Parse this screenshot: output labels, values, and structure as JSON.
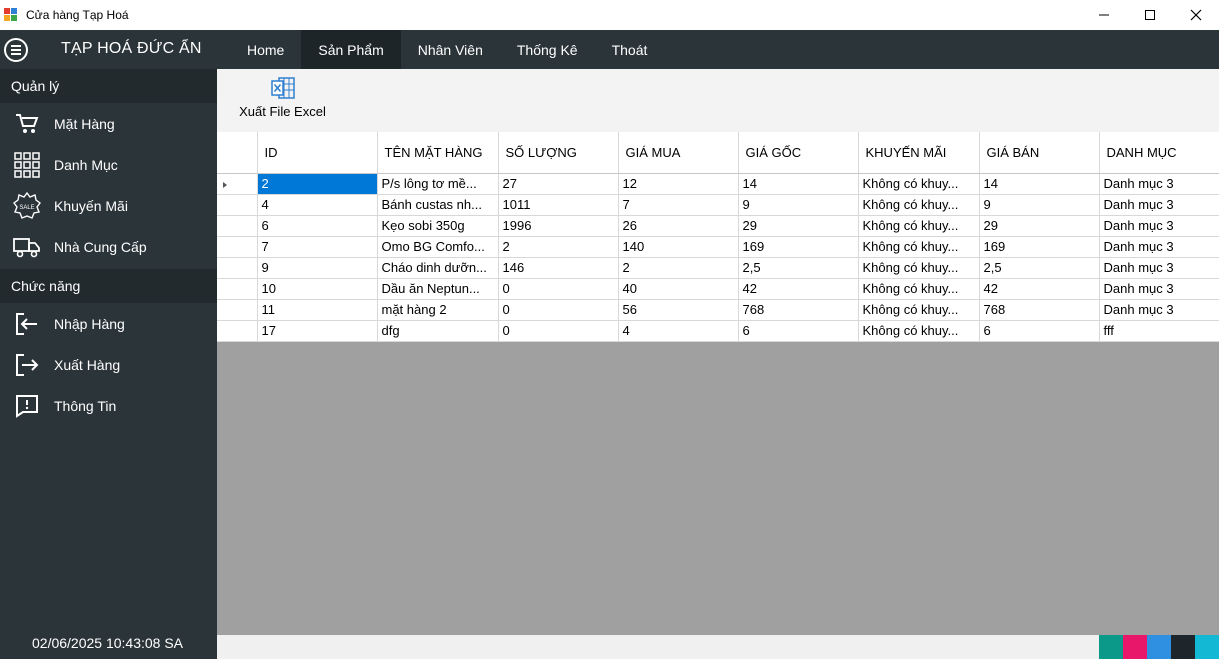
{
  "window": {
    "title": "Cửa hàng Tạp Hoá"
  },
  "header": {
    "brand": "TẠP HOÁ ĐỨC ẨN",
    "nav": [
      {
        "label": "Home",
        "active": false
      },
      {
        "label": "Sản Phẩm",
        "active": true
      },
      {
        "label": "Nhân Viên",
        "active": false
      },
      {
        "label": "Thống Kê",
        "active": false
      },
      {
        "label": "Thoát",
        "active": false
      }
    ]
  },
  "sidebar": {
    "section_manage": "Quản lý",
    "manage_items": [
      {
        "label": "Mặt Hàng",
        "icon": "cart-icon"
      },
      {
        "label": "Danh Mục",
        "icon": "category-grid-icon"
      },
      {
        "label": "Khuyến Mãi",
        "icon": "sale-badge-icon"
      },
      {
        "label": "Nhà Cung Cấp",
        "icon": "truck-icon"
      }
    ],
    "section_functions": "Chức năng",
    "function_items": [
      {
        "label": "Nhập Hàng",
        "icon": "import-icon"
      },
      {
        "label": "Xuất Hàng",
        "icon": "export-icon"
      },
      {
        "label": "Thông Tin",
        "icon": "info-icon"
      }
    ],
    "datetime": "02/06/2025 10:43:08 SA"
  },
  "toolbar": {
    "export_label": "Xuất File Excel"
  },
  "table": {
    "columns": [
      "ID",
      "TÊN MẶT HÀNG",
      "SỐ LƯỢNG",
      "GIÁ MUA",
      "GIÁ GỐC",
      "KHUYẾN MÃI",
      "GIÁ BÁN",
      "DANH MỤC"
    ],
    "rows": [
      [
        "2",
        "P/s lông tơ mề...",
        "27",
        "12",
        "14",
        "Không có khuy...",
        "14",
        "Danh mục 3"
      ],
      [
        "4",
        "Bánh custas nh...",
        "1011",
        "7",
        "9",
        "Không có khuy...",
        "9",
        "Danh mục 3"
      ],
      [
        "6",
        "Kẹo sobi 350g",
        "1996",
        "26",
        "29",
        "Không có khuy...",
        "29",
        "Danh mục 3"
      ],
      [
        "7",
        "Omo BG Comfo...",
        "2",
        "140",
        "169",
        "Không có khuy...",
        "169",
        "Danh mục 3"
      ],
      [
        "9",
        "Cháo dinh dưỡn...",
        "146",
        "2",
        "2,5",
        "Không có khuy...",
        "2,5",
        "Danh mục 3"
      ],
      [
        "10",
        "Dầu ăn Neptun...",
        "0",
        "40",
        "42",
        "Không có khuy...",
        "42",
        "Danh mục 3"
      ],
      [
        "11",
        "mặt hàng 2",
        "0",
        "56",
        "768",
        "Không có khuy...",
        "768",
        "Danh mục 3"
      ],
      [
        "17",
        "dfg",
        "0",
        "4",
        "6",
        "Không có khuy...",
        "6",
        "fff"
      ]
    ],
    "selected_row": 0
  },
  "colors": {
    "accent_selection": "#0078d7",
    "sidebar_bg": "#2b3439",
    "swatches": [
      "#0b9a8a",
      "#e8176a",
      "#2f8fe0",
      "#1e262b",
      "#12b8d4"
    ]
  }
}
